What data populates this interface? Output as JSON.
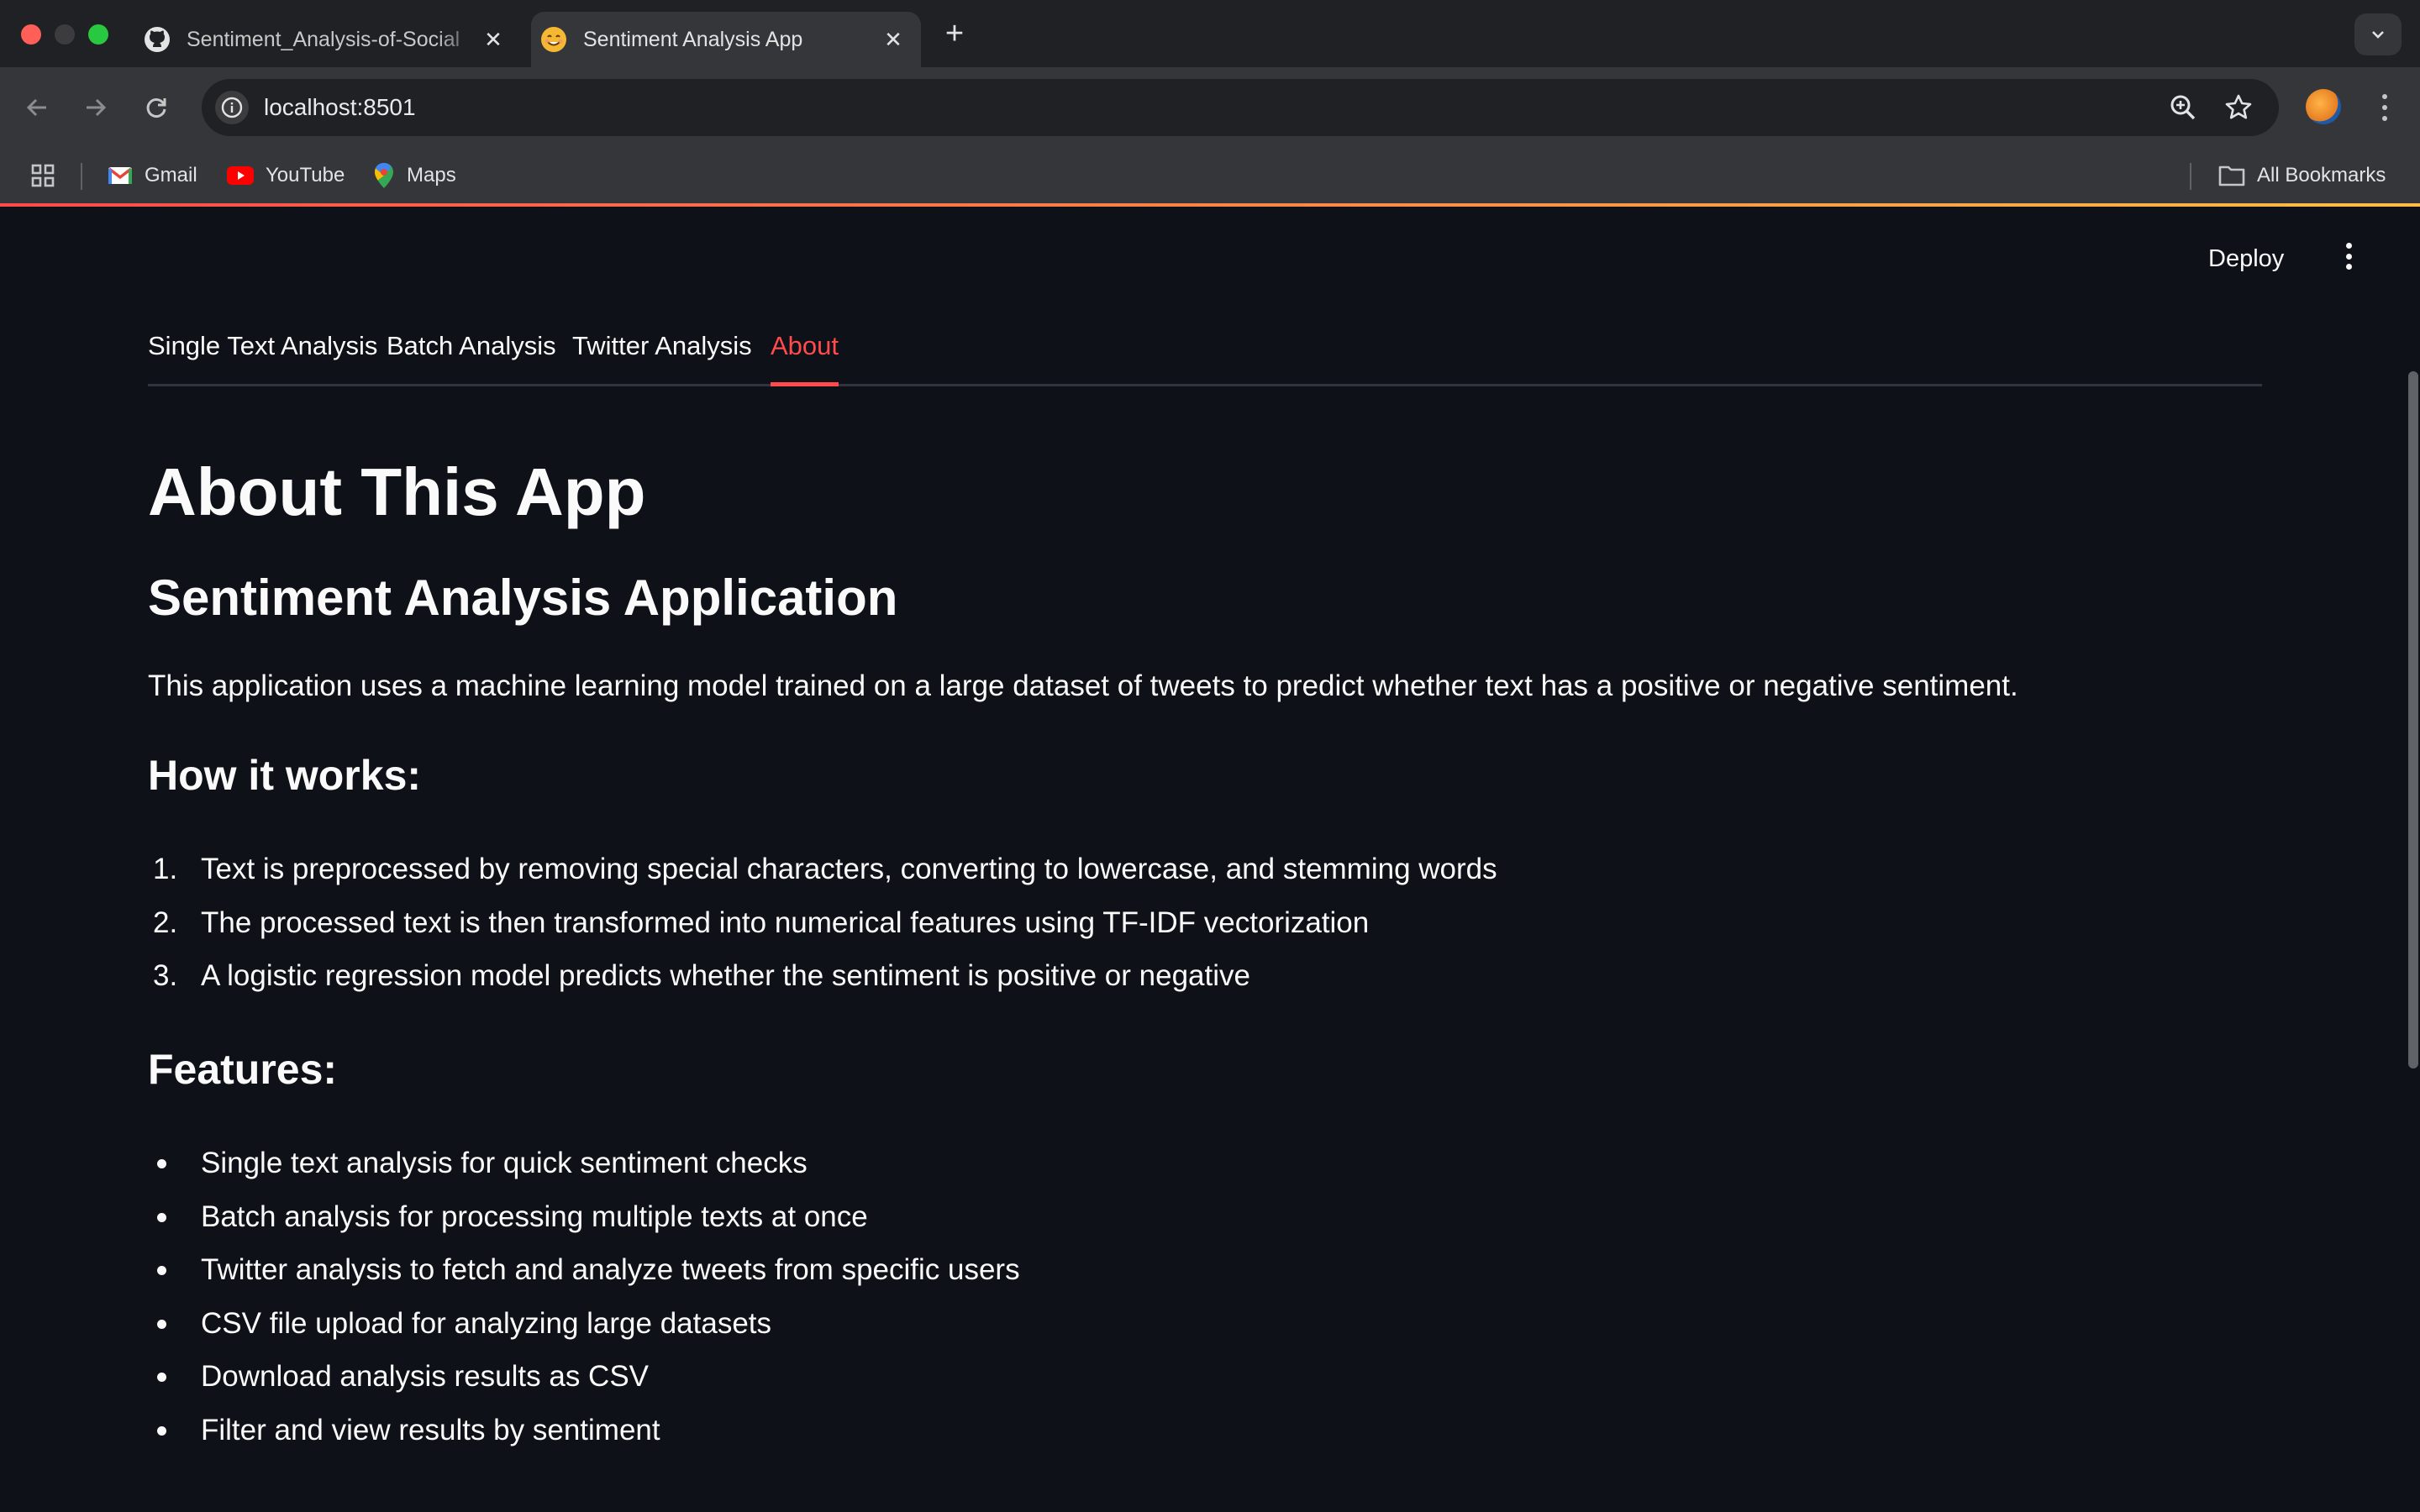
{
  "browser": {
    "tabs": [
      {
        "title": "Sentiment_Analysis-of-Social",
        "favicon": "github-icon",
        "active": false
      },
      {
        "title": "Sentiment Analysis App",
        "favicon": "smiley-emoji-icon",
        "active": true
      }
    ],
    "url": "localhost:8501",
    "bookmarks": [
      {
        "label": "Gmail",
        "icon": "gmail-icon"
      },
      {
        "label": "YouTube",
        "icon": "youtube-icon"
      },
      {
        "label": "Maps",
        "icon": "maps-icon"
      }
    ],
    "all_bookmarks_label": "All Bookmarks"
  },
  "app": {
    "deploy_label": "Deploy",
    "tabs": [
      "Single Text Analysis",
      "Batch Analysis",
      "Twitter Analysis",
      "About"
    ],
    "active_tab": "About",
    "accent_color": "#ff4b4b",
    "title": "About This App",
    "subtitle": "Sentiment Analysis Application",
    "description": "This application uses a machine learning model trained on a large dataset of tweets to predict whether text has a positive or negative sentiment.",
    "how_heading": "How it works:",
    "steps": [
      {
        "num": "1.",
        "text": "Text is preprocessed by removing special characters, converting to lowercase, and stemming words"
      },
      {
        "num": "2.",
        "text": "The processed text is then transformed into numerical features using TF-IDF vectorization"
      },
      {
        "num": "3.",
        "text": "A logistic regression model predicts whether the sentiment is positive or negative"
      }
    ],
    "features_heading": "Features:",
    "features": [
      "Single text analysis for quick sentiment checks",
      "Batch analysis for processing multiple texts at once",
      "Twitter analysis to fetch and analyze tweets from specific users",
      "CSV file upload for analyzing large datasets",
      "Download analysis results as CSV",
      "Filter and view results by sentiment"
    ]
  }
}
